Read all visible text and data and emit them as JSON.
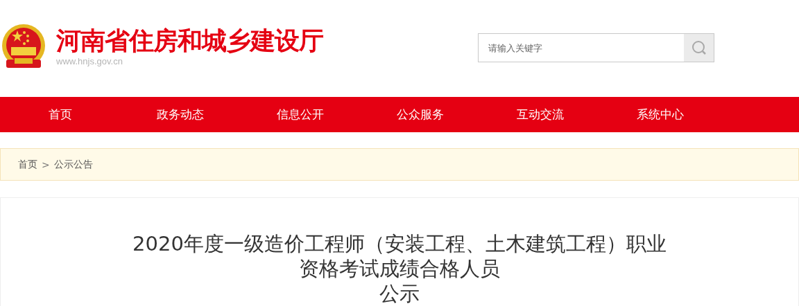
{
  "header": {
    "site_title": "河南省住房和城乡建设厅",
    "site_url": "www.hnjs.gov.cn"
  },
  "search": {
    "placeholder": "请输入关键字"
  },
  "nav": [
    {
      "label": "首页",
      "selected": false
    },
    {
      "label": "政务动态",
      "selected": false
    },
    {
      "label": "信息公开",
      "selected": false
    },
    {
      "label": "公众服务",
      "selected": false
    },
    {
      "label": "互动交流",
      "selected": false
    },
    {
      "label": "系统中心",
      "selected": false
    }
  ],
  "breadcrumb": [
    {
      "kind": "link",
      "text": "首页"
    },
    {
      "kind": "separator",
      "text": ">"
    },
    {
      "kind": "link",
      "text": "公示公告"
    }
  ],
  "article": {
    "title_lines": [
      "2020年度一级造价工程师（安装工程、土木建筑工程）职业",
      "资格考试成绩合格人员",
      "公示"
    ]
  }
}
